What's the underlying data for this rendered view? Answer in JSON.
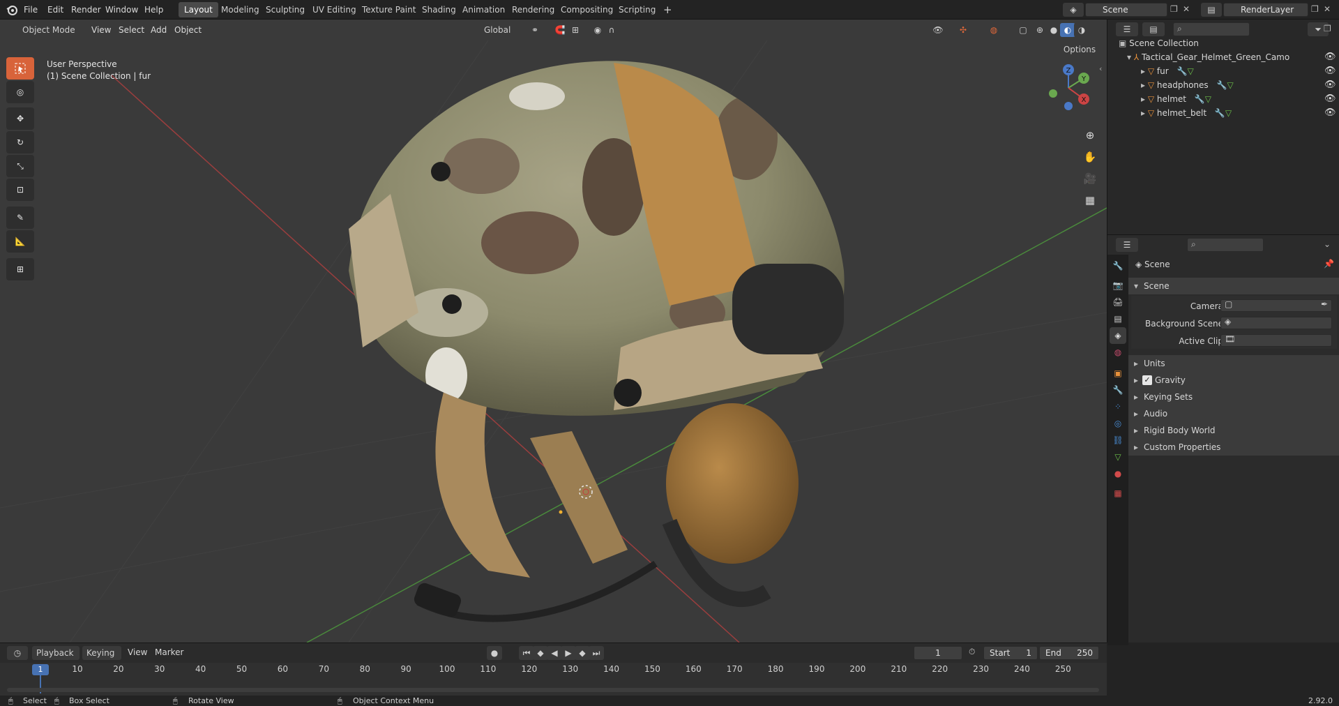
{
  "topbar": {
    "menus": [
      "File",
      "Edit",
      "Render",
      "Window",
      "Help"
    ],
    "workspaces": [
      "Layout",
      "Modeling",
      "Sculpting",
      "UV Editing",
      "Texture Paint",
      "Shading",
      "Animation",
      "Rendering",
      "Compositing",
      "Scripting"
    ],
    "active_workspace": "Layout",
    "scene_name": "Scene",
    "view_layer": "RenderLayer"
  },
  "viewport": {
    "mode": "Object Mode",
    "menus": [
      "View",
      "Select",
      "Add",
      "Object"
    ],
    "orientation": "Global",
    "options": "Options",
    "overlay_title": "User Perspective",
    "overlay_sub": "(1) Scene Collection | fur",
    "gizmo": {
      "x": "X",
      "y": "Y",
      "z": "Z"
    }
  },
  "outliner": {
    "root": "Scene Collection",
    "collection": "Tactical_Gear_Helmet_Green_Camo",
    "objects": [
      "fur",
      "headphones",
      "helmet",
      "helmet_belt"
    ]
  },
  "properties": {
    "context": "Scene",
    "panel": "Scene",
    "camera_label": "Camera",
    "background_label": "Background Scene",
    "clip_label": "Active Clip",
    "sections": [
      "Units",
      "Gravity",
      "Keying Sets",
      "Audio",
      "Rigid Body World",
      "Custom Properties"
    ],
    "gravity_checked": true
  },
  "timeline": {
    "menus": [
      "Playback",
      "Keying",
      "View",
      "Marker"
    ],
    "current_frame": "1",
    "start_label": "Start",
    "start": "1",
    "end_label": "End",
    "end": "250",
    "ticks": [
      "10",
      "20",
      "30",
      "40",
      "50",
      "60",
      "70",
      "80",
      "90",
      "100",
      "110",
      "120",
      "130",
      "140",
      "150",
      "160",
      "170",
      "180",
      "190",
      "200",
      "210",
      "220",
      "230",
      "240",
      "250"
    ],
    "playhead": "1"
  },
  "status": {
    "select": "Select",
    "box_select": "Box Select",
    "rotate": "Rotate View",
    "context_menu": "Object Context Menu",
    "version": "2.92.0"
  },
  "colors": {
    "accent": "#d8633a",
    "object_orange": "#e8913b",
    "selection_blue": "#4772b3"
  }
}
